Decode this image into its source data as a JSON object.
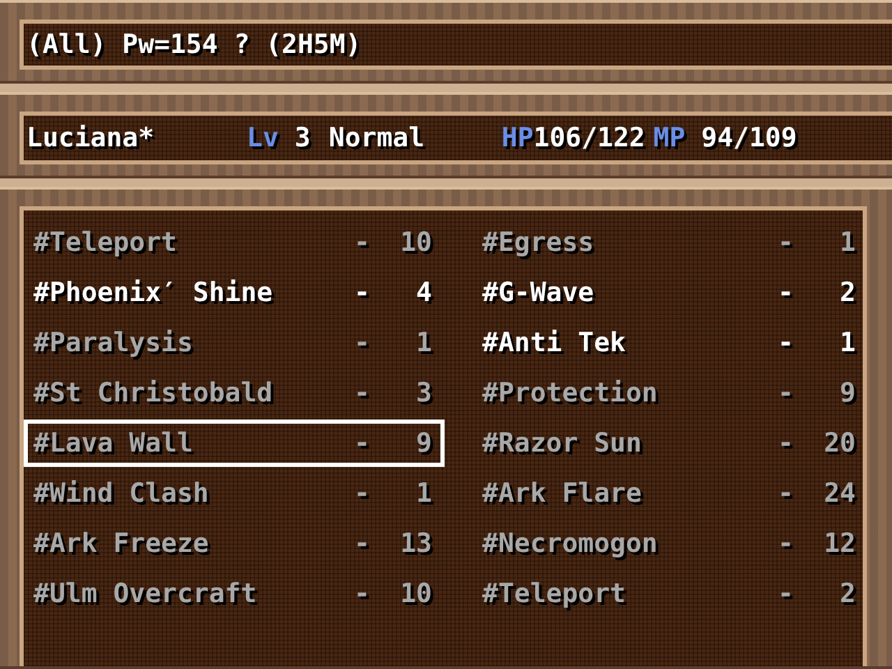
{
  "help": {
    "text": "(All) Pw=154 ? (2H5M)"
  },
  "character": {
    "name": "Luciana*",
    "level_label": "Lv",
    "level": "3",
    "condition": "Normal",
    "hp_label": "HP",
    "hp": "106/122",
    "mp_label": "MP",
    "mp": "94/109"
  },
  "skills": [
    {
      "name": "#Teleport",
      "dash": "-",
      "cost": "10",
      "disabled": true,
      "selected": false
    },
    {
      "name": "#Egress",
      "dash": "-",
      "cost": "1",
      "disabled": true,
      "selected": false
    },
    {
      "name": "#Phoenix′ Shine",
      "dash": "-",
      "cost": "4",
      "disabled": false,
      "selected": false
    },
    {
      "name": "#G-Wave",
      "dash": "-",
      "cost": "2",
      "disabled": false,
      "selected": false
    },
    {
      "name": "#Paralysis",
      "dash": "-",
      "cost": "1",
      "disabled": true,
      "selected": false
    },
    {
      "name": "#Anti Tek",
      "dash": "-",
      "cost": "1",
      "disabled": false,
      "selected": false
    },
    {
      "name": "#St Christobald",
      "dash": "-",
      "cost": "3",
      "disabled": true,
      "selected": false
    },
    {
      "name": "#Protection",
      "dash": "-",
      "cost": "9",
      "disabled": true,
      "selected": false
    },
    {
      "name": "#Lava Wall",
      "dash": "-",
      "cost": "9",
      "disabled": true,
      "selected": true
    },
    {
      "name": "#Razor Sun",
      "dash": "-",
      "cost": "20",
      "disabled": true,
      "selected": false
    },
    {
      "name": "#Wind Clash",
      "dash": "-",
      "cost": "1",
      "disabled": true,
      "selected": false
    },
    {
      "name": "#Ark Flare",
      "dash": "-",
      "cost": "24",
      "disabled": true,
      "selected": false
    },
    {
      "name": "#Ark Freeze",
      "dash": "-",
      "cost": "13",
      "disabled": true,
      "selected": false
    },
    {
      "name": "#Necromogon",
      "dash": "-",
      "cost": "12",
      "disabled": true,
      "selected": false
    },
    {
      "name": "#Ulm Overcraft",
      "dash": "-",
      "cost": "10",
      "disabled": true,
      "selected": false
    },
    {
      "name": "#Teleport",
      "dash": "-",
      "cost": "2",
      "disabled": true,
      "selected": false
    }
  ]
}
